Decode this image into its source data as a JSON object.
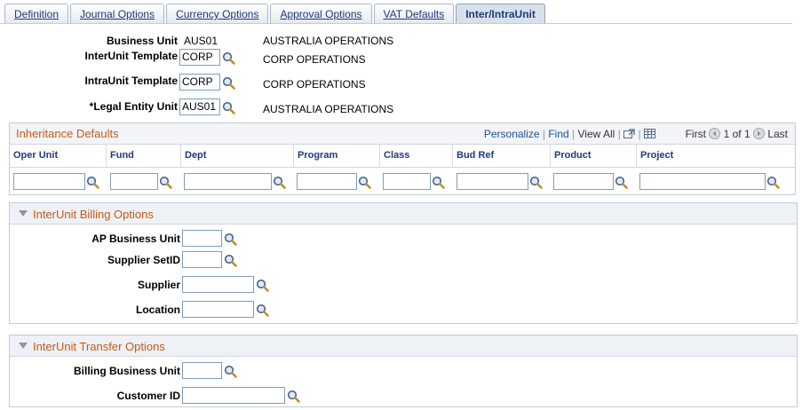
{
  "tabs": [
    {
      "label": "Definition",
      "active": false
    },
    {
      "label": "Journal Options",
      "active": false
    },
    {
      "label": "Currency Options",
      "active": false
    },
    {
      "label": "Approval Options",
      "active": false
    },
    {
      "label": "VAT Defaults",
      "active": false
    },
    {
      "label": "Inter/IntraUnit",
      "active": true
    }
  ],
  "header": {
    "business_unit_label": "Business Unit",
    "business_unit_value": "AUS01",
    "business_unit_desc": "AUSTRALIA OPERATIONS",
    "interunit_label": "InterUnit Template",
    "interunit_value": "CORP",
    "interunit_desc": "CORP OPERATIONS",
    "intraunit_label": "IntraUnit Template",
    "intraunit_value": "CORP",
    "intraunit_desc": "CORP OPERATIONS",
    "legal_label": "*Legal Entity Unit",
    "legal_value": "AUS01",
    "legal_desc": "AUSTRALIA OPERATIONS"
  },
  "grid": {
    "title": "Inheritance Defaults",
    "personalize": "Personalize",
    "find": "Find",
    "view_all": "View All",
    "first": "First",
    "pages": "1 of 1",
    "last": "Last",
    "columns": [
      "Oper Unit",
      "Fund",
      "Dept",
      "Program",
      "Class",
      "Bud Ref",
      "Product",
      "Project"
    ]
  },
  "billing": {
    "title": "InterUnit Billing Options",
    "ap_bu_label": "AP Business Unit",
    "setid_label": "Supplier SetID",
    "supplier_label": "Supplier",
    "location_label": "Location"
  },
  "transfer": {
    "title": "InterUnit Transfer Options",
    "billing_bu_label": "Billing Business Unit",
    "customer_label": "Customer ID"
  },
  "colors": {
    "accent": "#c65a14",
    "link": "#1f4e9a",
    "tab_text": "#1f3a7a"
  },
  "icons": {
    "lookup": "magnifier-icon",
    "collapse": "triangle-down-icon",
    "nav_prev": "arrow-left-circle-icon",
    "nav_next": "arrow-right-circle-icon"
  }
}
